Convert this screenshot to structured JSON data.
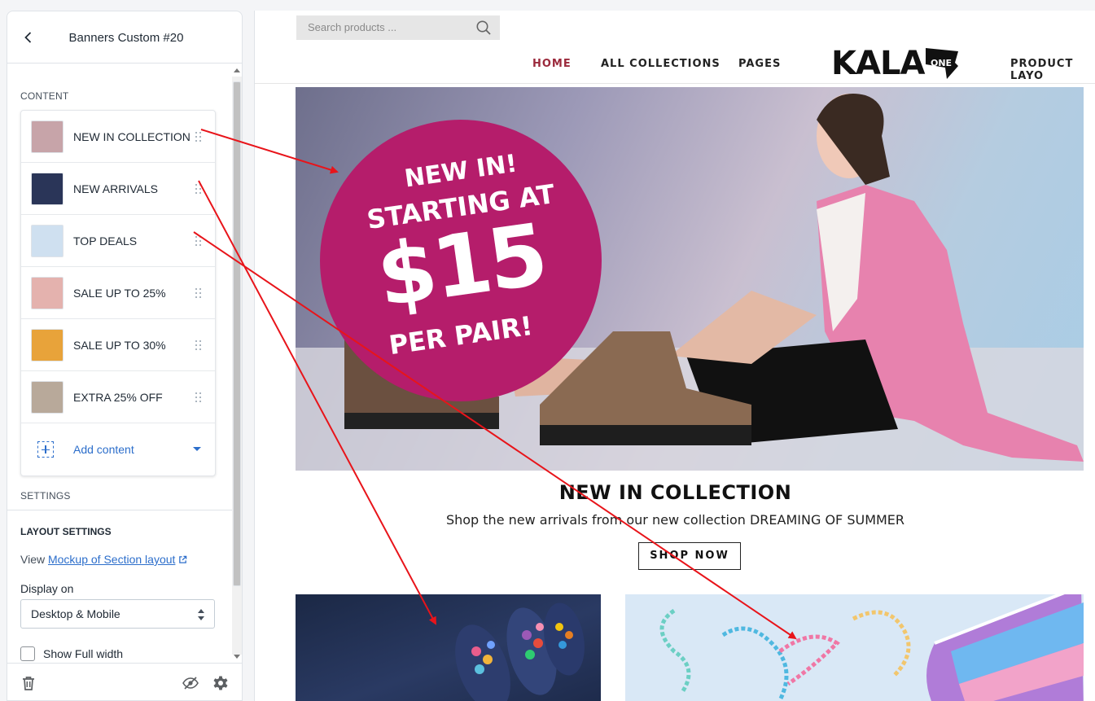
{
  "sidebar": {
    "title": "Banners Custom #20",
    "content_heading": "CONTENT",
    "blocks": [
      {
        "label": "NEW IN COLLECTION",
        "thumb_color": "#c7a4a9"
      },
      {
        "label": "NEW ARRIVALS",
        "thumb_color": "#2a3558"
      },
      {
        "label": "TOP DEALS",
        "thumb_color": "#cfe0f0"
      },
      {
        "label": "SALE UP TO 25%",
        "thumb_color": "#e4b2ae"
      },
      {
        "label": "SALE UP TO 30%",
        "thumb_color": "#e8a33a"
      },
      {
        "label": "EXTRA 25% OFF",
        "thumb_color": "#b8a99a"
      }
    ],
    "add_content_label": "Add content",
    "settings_heading": "SETTINGS",
    "layout_settings_heading": "LAYOUT SETTINGS",
    "view_prefix": "View",
    "mockup_link": "Mockup of Section layout",
    "display_on_label": "Display on",
    "display_on_value": "Desktop & Mobile",
    "show_full_width_label": "Show Full width",
    "show_full_width_checked": false
  },
  "preview": {
    "search_placeholder": "Search products ...",
    "nav": [
      "HOME",
      "ALL COLLECTIONS",
      "PAGES",
      "PRODUCT LAYO"
    ],
    "active_nav": "HOME",
    "logo_text": "KALA",
    "logo_badge": "ONE",
    "hero_badge": {
      "line1": "NEW IN!",
      "line2": "STARTING AT",
      "price": "$15",
      "line4": "PER PAIR!"
    },
    "hero_title": "NEW IN COLLECTION",
    "hero_subtitle": "Shop the new arrivals from our new collection DREAMING OF SUMMER",
    "shop_button": "SHOP NOW"
  },
  "colors": {
    "accent": "#2c6ecb",
    "nav_active": "#9b2a3c",
    "badge": "#b51d6b",
    "annotation_arrow": "#e8141a"
  }
}
